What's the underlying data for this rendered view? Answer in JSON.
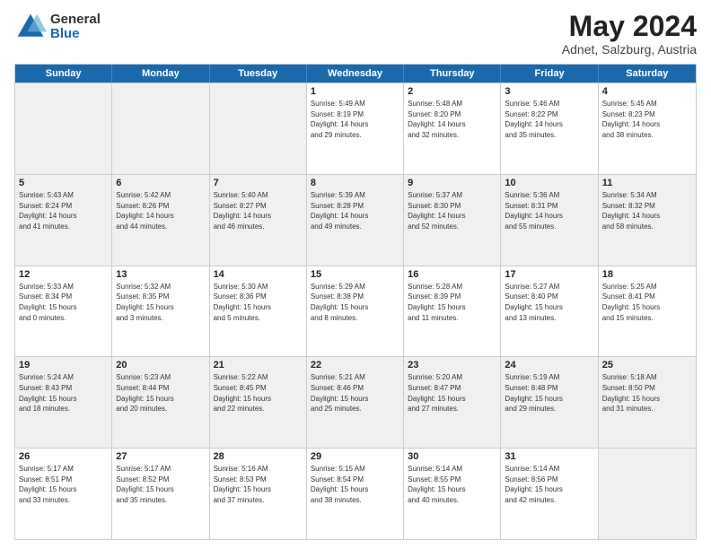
{
  "logo": {
    "general": "General",
    "blue": "Blue"
  },
  "title": "May 2024",
  "subtitle": "Adnet, Salzburg, Austria",
  "header_days": [
    "Sunday",
    "Monday",
    "Tuesday",
    "Wednesday",
    "Thursday",
    "Friday",
    "Saturday"
  ],
  "weeks": [
    [
      {
        "day": "",
        "info": ""
      },
      {
        "day": "",
        "info": ""
      },
      {
        "day": "",
        "info": ""
      },
      {
        "day": "1",
        "info": "Sunrise: 5:49 AM\nSunset: 8:19 PM\nDaylight: 14 hours\nand 29 minutes."
      },
      {
        "day": "2",
        "info": "Sunrise: 5:48 AM\nSunset: 8:20 PM\nDaylight: 14 hours\nand 32 minutes."
      },
      {
        "day": "3",
        "info": "Sunrise: 5:46 AM\nSunset: 8:22 PM\nDaylight: 14 hours\nand 35 minutes."
      },
      {
        "day": "4",
        "info": "Sunrise: 5:45 AM\nSunset: 8:23 PM\nDaylight: 14 hours\nand 38 minutes."
      }
    ],
    [
      {
        "day": "5",
        "info": "Sunrise: 5:43 AM\nSunset: 8:24 PM\nDaylight: 14 hours\nand 41 minutes."
      },
      {
        "day": "6",
        "info": "Sunrise: 5:42 AM\nSunset: 8:26 PM\nDaylight: 14 hours\nand 44 minutes."
      },
      {
        "day": "7",
        "info": "Sunrise: 5:40 AM\nSunset: 8:27 PM\nDaylight: 14 hours\nand 46 minutes."
      },
      {
        "day": "8",
        "info": "Sunrise: 5:39 AM\nSunset: 8:28 PM\nDaylight: 14 hours\nand 49 minutes."
      },
      {
        "day": "9",
        "info": "Sunrise: 5:37 AM\nSunset: 8:30 PM\nDaylight: 14 hours\nand 52 minutes."
      },
      {
        "day": "10",
        "info": "Sunrise: 5:36 AM\nSunset: 8:31 PM\nDaylight: 14 hours\nand 55 minutes."
      },
      {
        "day": "11",
        "info": "Sunrise: 5:34 AM\nSunset: 8:32 PM\nDaylight: 14 hours\nand 58 minutes."
      }
    ],
    [
      {
        "day": "12",
        "info": "Sunrise: 5:33 AM\nSunset: 8:34 PM\nDaylight: 15 hours\nand 0 minutes."
      },
      {
        "day": "13",
        "info": "Sunrise: 5:32 AM\nSunset: 8:35 PM\nDaylight: 15 hours\nand 3 minutes."
      },
      {
        "day": "14",
        "info": "Sunrise: 5:30 AM\nSunset: 8:36 PM\nDaylight: 15 hours\nand 5 minutes."
      },
      {
        "day": "15",
        "info": "Sunrise: 5:29 AM\nSunset: 8:38 PM\nDaylight: 15 hours\nand 8 minutes."
      },
      {
        "day": "16",
        "info": "Sunrise: 5:28 AM\nSunset: 8:39 PM\nDaylight: 15 hours\nand 11 minutes."
      },
      {
        "day": "17",
        "info": "Sunrise: 5:27 AM\nSunset: 8:40 PM\nDaylight: 15 hours\nand 13 minutes."
      },
      {
        "day": "18",
        "info": "Sunrise: 5:25 AM\nSunset: 8:41 PM\nDaylight: 15 hours\nand 15 minutes."
      }
    ],
    [
      {
        "day": "19",
        "info": "Sunrise: 5:24 AM\nSunset: 8:43 PM\nDaylight: 15 hours\nand 18 minutes."
      },
      {
        "day": "20",
        "info": "Sunrise: 5:23 AM\nSunset: 8:44 PM\nDaylight: 15 hours\nand 20 minutes."
      },
      {
        "day": "21",
        "info": "Sunrise: 5:22 AM\nSunset: 8:45 PM\nDaylight: 15 hours\nand 22 minutes."
      },
      {
        "day": "22",
        "info": "Sunrise: 5:21 AM\nSunset: 8:46 PM\nDaylight: 15 hours\nand 25 minutes."
      },
      {
        "day": "23",
        "info": "Sunrise: 5:20 AM\nSunset: 8:47 PM\nDaylight: 15 hours\nand 27 minutes."
      },
      {
        "day": "24",
        "info": "Sunrise: 5:19 AM\nSunset: 8:48 PM\nDaylight: 15 hours\nand 29 minutes."
      },
      {
        "day": "25",
        "info": "Sunrise: 5:18 AM\nSunset: 8:50 PM\nDaylight: 15 hours\nand 31 minutes."
      }
    ],
    [
      {
        "day": "26",
        "info": "Sunrise: 5:17 AM\nSunset: 8:51 PM\nDaylight: 15 hours\nand 33 minutes."
      },
      {
        "day": "27",
        "info": "Sunrise: 5:17 AM\nSunset: 8:52 PM\nDaylight: 15 hours\nand 35 minutes."
      },
      {
        "day": "28",
        "info": "Sunrise: 5:16 AM\nSunset: 8:53 PM\nDaylight: 15 hours\nand 37 minutes."
      },
      {
        "day": "29",
        "info": "Sunrise: 5:15 AM\nSunset: 8:54 PM\nDaylight: 15 hours\nand 38 minutes."
      },
      {
        "day": "30",
        "info": "Sunrise: 5:14 AM\nSunset: 8:55 PM\nDaylight: 15 hours\nand 40 minutes."
      },
      {
        "day": "31",
        "info": "Sunrise: 5:14 AM\nSunset: 8:56 PM\nDaylight: 15 hours\nand 42 minutes."
      },
      {
        "day": "",
        "info": ""
      }
    ]
  ]
}
